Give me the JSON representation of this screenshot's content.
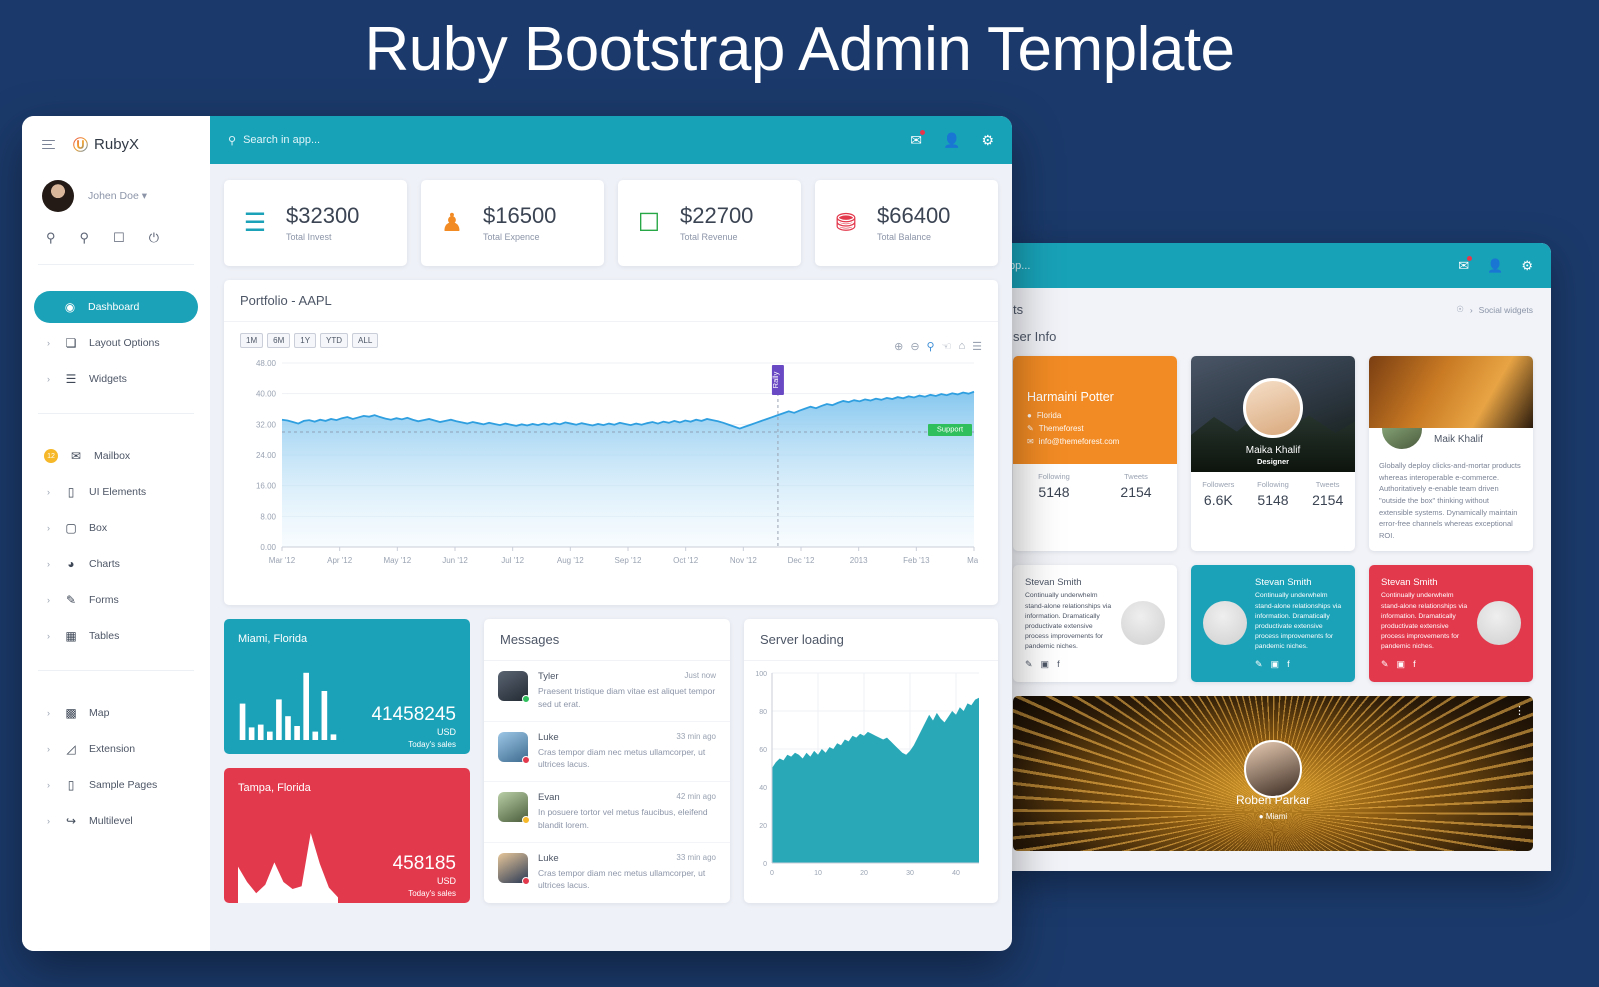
{
  "banner": {
    "title": "Ruby Bootstrap Admin Template"
  },
  "colors": {
    "background": "#1b3a6b",
    "accent_teal": "#1ba2b8",
    "accent_red": "#e3394d",
    "accent_orange": "#f28b24",
    "accent_green": "#27a745",
    "badge_yellow": "#f6b728"
  },
  "window1": {
    "brand": {
      "logo_icon": "rubyx-logo-icon",
      "name": "RubyX",
      "burger_icon": "hamburger-icon"
    },
    "user": {
      "name": "Johen Doe",
      "caret": "▾",
      "avatar_icon": "user-avatar"
    },
    "quick_icons": [
      {
        "name": "search-icon",
        "glyph": "⌕"
      },
      {
        "name": "bell-icon",
        "glyph": "🔔"
      },
      {
        "name": "chat-icon",
        "glyph": "💬"
      },
      {
        "name": "power-icon",
        "glyph": "⏻"
      }
    ],
    "topbar": {
      "search_placeholder": "Search in app...",
      "search_icon": "search-icon",
      "icons": [
        {
          "name": "mail-icon",
          "glyph": "✉",
          "badge": true
        },
        {
          "name": "user-icon",
          "glyph": "👤",
          "badge": false
        },
        {
          "name": "gear-icon",
          "glyph": "⚙",
          "badge": false
        }
      ]
    },
    "nav": {
      "group1": [
        {
          "label": "Dashboard",
          "icon": "dashboard-icon",
          "glyph": "◉",
          "active": true,
          "chevron": false,
          "badge": null
        },
        {
          "label": "Layout Options",
          "icon": "layers-icon",
          "glyph": "❏",
          "active": false,
          "chevron": true,
          "badge": null
        },
        {
          "label": "Widgets",
          "icon": "widgets-icon",
          "glyph": "☰",
          "active": false,
          "chevron": true,
          "badge": null
        }
      ],
      "group2": [
        {
          "label": "Mailbox",
          "icon": "mail-icon",
          "glyph": "✉",
          "active": false,
          "chevron": false,
          "badge": "12"
        },
        {
          "label": "UI Elements",
          "icon": "laptop-icon",
          "glyph": "▭",
          "active": false,
          "chevron": true,
          "badge": null
        },
        {
          "label": "Box",
          "icon": "box-icon",
          "glyph": "▢",
          "active": false,
          "chevron": true,
          "badge": null
        },
        {
          "label": "Charts",
          "icon": "pie-chart-icon",
          "glyph": "◕",
          "active": false,
          "chevron": true,
          "badge": null
        },
        {
          "label": "Forms",
          "icon": "form-edit-icon",
          "glyph": "✎",
          "active": false,
          "chevron": true,
          "badge": null
        },
        {
          "label": "Tables",
          "icon": "table-icon",
          "glyph": "▦",
          "active": false,
          "chevron": true,
          "badge": null
        }
      ],
      "group3": [
        {
          "label": "Map",
          "icon": "map-icon",
          "glyph": "🗺",
          "active": false,
          "chevron": true,
          "badge": null
        },
        {
          "label": "Extension",
          "icon": "plug-icon",
          "glyph": "🔌",
          "active": false,
          "chevron": true,
          "badge": null
        },
        {
          "label": "Sample Pages",
          "icon": "page-icon",
          "glyph": "📄",
          "active": false,
          "chevron": true,
          "badge": null
        },
        {
          "label": "Multilevel",
          "icon": "arrow-return-icon",
          "glyph": "↪",
          "active": false,
          "chevron": true,
          "badge": null
        }
      ]
    },
    "kpis": [
      {
        "value": "$32300",
        "label": "Total Invest",
        "icon": "invoice-icon",
        "glyph": "▤",
        "color": "#1ba2b8"
      },
      {
        "value": "$16500",
        "label": "Total Expence",
        "icon": "stamp-icon",
        "glyph": "♟",
        "color": "#f28b24"
      },
      {
        "value": "$22700",
        "label": "Total Revenue",
        "icon": "document-icon",
        "glyph": "🗎",
        "color": "#27a745"
      },
      {
        "value": "$66400",
        "label": "Total Balance",
        "icon": "briefcase-icon",
        "glyph": "🧰",
        "color": "#e3394d"
      }
    ],
    "portfolio": {
      "title": "Portfolio - AAPL",
      "ranges": [
        "1M",
        "6M",
        "1Y",
        "YTD",
        "ALL"
      ],
      "tools": [
        {
          "name": "zoom-in-icon",
          "glyph": "⊕"
        },
        {
          "name": "zoom-out-icon",
          "glyph": "⊖"
        },
        {
          "name": "selection-zoom-icon",
          "glyph": "⌕"
        },
        {
          "name": "pan-icon",
          "glyph": "✋"
        },
        {
          "name": "home-reset-icon",
          "glyph": "⌂"
        },
        {
          "name": "menu-icon",
          "glyph": "☰"
        }
      ]
    },
    "tiles": [
      {
        "city": "Miami, Florida",
        "amount": "41458245",
        "currency": "USD",
        "caption": "Today's sales",
        "color": "teal"
      },
      {
        "city": "Tampa, Florida",
        "amount": "458185",
        "currency": "USD",
        "caption": "Today's sales",
        "color": "red"
      }
    ],
    "messages": {
      "title": "Messages",
      "items": [
        {
          "name": "Tyler",
          "time": "Just now",
          "text": "Praesent tristique diam vitae est aliquet tempor sed ut erat.",
          "status_color": "#2fbf5c"
        },
        {
          "name": "Luke",
          "time": "33 min ago",
          "text": "Cras tempor diam nec metus ullamcorper, ut ultrices lacus.",
          "status_color": "#e3394d"
        },
        {
          "name": "Evan",
          "time": "42 min ago",
          "text": "In posuere tortor vel metus faucibus, eleifend blandit lorem.",
          "status_color": "#f6b728"
        },
        {
          "name": "Luke",
          "time": "33 min ago",
          "text": "Cras tempor diam nec metus ullamcorper, ut ultrices lacus.",
          "status_color": "#e3394d"
        }
      ]
    },
    "server": {
      "title": "Server loading"
    }
  },
  "window2": {
    "topbar": {
      "search_placeholder": "pp...",
      "icons": [
        {
          "name": "mail-icon",
          "glyph": "✉",
          "badge": true
        },
        {
          "name": "user-icon",
          "glyph": "👤",
          "badge": false
        },
        {
          "name": "gear-icon",
          "glyph": "⚙",
          "badge": false
        }
      ]
    },
    "page_title": "ts",
    "breadcrumb": {
      "home_icon": "home-icon",
      "separator": "›",
      "current": "Social widgets"
    },
    "section_title": "ser Info",
    "cards": [
      {
        "name": "Harmaini Potter",
        "location": "Florida",
        "handle": "Themeforest",
        "email": "info@themeforest.com",
        "location_icon": "pin-icon",
        "twitter_icon": "twitter-icon",
        "mail_icon": "mail-icon",
        "stats": [
          {
            "label": "Following",
            "value": "5148"
          },
          {
            "label": "Tweets",
            "value": "2154"
          }
        ]
      },
      {
        "name": "Maika Khalif",
        "role": "Designer",
        "stats": [
          {
            "label": "Followers",
            "value": "6.6K"
          },
          {
            "label": "Following",
            "value": "5148"
          },
          {
            "label": "Tweets",
            "value": "2154"
          }
        ]
      },
      {
        "name": "Maik Khalif",
        "bio": "Globally deploy clicks-and-mortar products whereas interoperable e-commerce. Authoritatively e-enable team driven \"outside the box\" thinking without extensible systems. Dynamically maintain error-free channels whereas exceptional ROI."
      }
    ],
    "stevan_cards": [
      {
        "name": "Stevan Smith",
        "text": "Continually underwhelm stand-alone relationships via information. Dramatically productivate extensive process improvements for pandemic niches.",
        "theme": "white",
        "avatar_side": "right"
      },
      {
        "name": "Stevan Smith",
        "text": "Continually underwhelm stand-alone relationships via information. Dramatically productivate extensive process improvements for pandemic niches.",
        "theme": "teal",
        "avatar_side": "left"
      },
      {
        "name": "Stevan Smith",
        "text": "Continually underwhelm stand-alone relationships via information. Dramatically productivate extensive process improvements for pandemic niches.",
        "theme": "red",
        "avatar_side": "right"
      }
    ],
    "social_icons": [
      {
        "name": "twitter-icon",
        "glyph": "🐦"
      },
      {
        "name": "instagram-icon",
        "glyph": "◙"
      },
      {
        "name": "facebook-icon",
        "glyph": "f"
      }
    ],
    "banner": {
      "name": "Roben Parkar",
      "location": "Miami",
      "pin_icon": "pin-icon",
      "kebab_icon": "more-vertical-icon"
    }
  },
  "chart_data": [
    {
      "type": "area",
      "title": "Portfolio - AAPL",
      "xlabel": "",
      "ylabel": "",
      "ylim": [
        0,
        48
      ],
      "yticks": [
        0.0,
        8.0,
        16.0,
        24.0,
        32.0,
        40.0,
        48.0
      ],
      "ytick_labels": [
        "0.00",
        "8.00",
        "16.00",
        "24.00",
        "32.00",
        "40.00",
        "48.00"
      ],
      "xtick_labels": [
        "Mar '12",
        "Apr '12",
        "May '12",
        "Jun '12",
        "Jul '12",
        "Aug '12",
        "Sep '12",
        "Oct '12",
        "Nov '12",
        "Dec '12",
        "2013",
        "Feb '13",
        "Mar"
      ],
      "grid": true,
      "legend": "none",
      "line_color": "#2f9fe0",
      "annotations": [
        {
          "label": "Rally",
          "type": "vertical-flag",
          "color": "#6a49c4",
          "x_index": 8.6
        },
        {
          "label": "Support",
          "type": "level-label",
          "color": "#2fbf5c",
          "y": 30.0
        }
      ],
      "values": [
        33.2,
        33.0,
        32.6,
        32.2,
        32.9,
        33.1,
        32.7,
        33.2,
        32.9,
        33.4,
        33.1,
        33.6,
        33.9,
        33.4,
        33.8,
        34.2,
        34.0,
        34.4,
        33.9,
        33.5,
        33.2,
        33.6,
        33.3,
        33.7,
        33.2,
        32.8,
        33.1,
        33.4,
        33.0,
        32.6,
        32.9,
        33.2,
        32.8,
        32.5,
        32.2,
        32.6,
        32.3,
        32.0,
        32.4,
        32.1,
        31.8,
        32.2,
        31.9,
        31.6,
        32.0,
        31.7,
        32.1,
        31.8,
        32.2,
        31.9,
        32.3,
        32.0,
        32.5,
        32.2,
        31.9,
        32.3,
        32.0,
        31.7,
        32.1,
        31.8,
        32.2,
        31.9,
        32.4,
        32.1,
        31.8,
        32.2,
        31.9,
        32.3,
        32.6,
        32.2,
        32.7,
        32.4,
        32.9,
        32.5,
        33.0,
        32.7,
        33.2,
        32.9,
        33.4,
        33.1,
        32.8,
        32.4,
        31.9,
        31.4,
        30.9,
        31.4,
        31.9,
        32.4,
        32.9,
        33.4,
        33.9,
        34.4,
        34.9,
        35.4,
        35.0,
        35.6,
        36.1,
        36.6,
        36.2,
        36.8,
        37.3,
        37.0,
        37.6,
        38.1,
        37.8,
        38.3,
        38.0,
        38.5,
        38.2,
        38.7,
        38.4,
        38.9,
        38.6,
        39.1,
        38.8,
        39.3,
        39.0,
        39.5,
        39.2,
        39.7,
        39.4,
        39.9,
        39.6,
        40.1,
        39.8,
        40.3,
        40.0,
        40.5
      ]
    },
    {
      "type": "bar",
      "title": "Miami, Florida",
      "categories": [
        "1",
        "2",
        "3",
        "4",
        "5",
        "6",
        "7",
        "8",
        "9",
        "10",
        "11"
      ],
      "values": [
        52,
        18,
        22,
        12,
        58,
        34,
        20,
        96,
        12,
        70,
        8
      ],
      "ylim": [
        0,
        100
      ],
      "grid": false,
      "legend": "none",
      "color": "#ffffff"
    },
    {
      "type": "area",
      "title": "Tampa, Florida",
      "values": [
        52,
        30,
        14,
        26,
        58,
        30,
        20,
        24,
        100,
        56,
        22,
        8
      ],
      "ylim": [
        0,
        100
      ],
      "grid": false,
      "legend": "none",
      "color": "#ffffff"
    },
    {
      "type": "area",
      "title": "Server loading",
      "xlabel": "",
      "ylabel": "",
      "ylim": [
        0,
        100
      ],
      "yticks": [
        0,
        20,
        40,
        60,
        80,
        100
      ],
      "ytick_labels": [
        "0",
        "20",
        "40",
        "60",
        "80",
        "100"
      ],
      "xticks": [
        0,
        10,
        20,
        30,
        40
      ],
      "xtick_labels": [
        "0",
        "10",
        "20",
        "30",
        "40"
      ],
      "grid": true,
      "legend": "none",
      "color": "#29a8b8",
      "values": [
        50,
        53,
        55,
        54,
        57,
        56,
        58,
        57,
        55,
        58,
        56,
        59,
        57,
        60,
        58,
        61,
        60,
        63,
        62,
        65,
        64,
        67,
        66,
        68,
        67,
        69,
        68,
        67,
        66,
        65,
        66,
        64,
        62,
        60,
        58,
        57,
        59,
        62,
        66,
        70,
        74,
        78,
        75,
        79,
        76,
        74,
        77,
        80,
        78,
        82,
        80,
        84,
        83,
        86,
        87
      ]
    }
  ]
}
